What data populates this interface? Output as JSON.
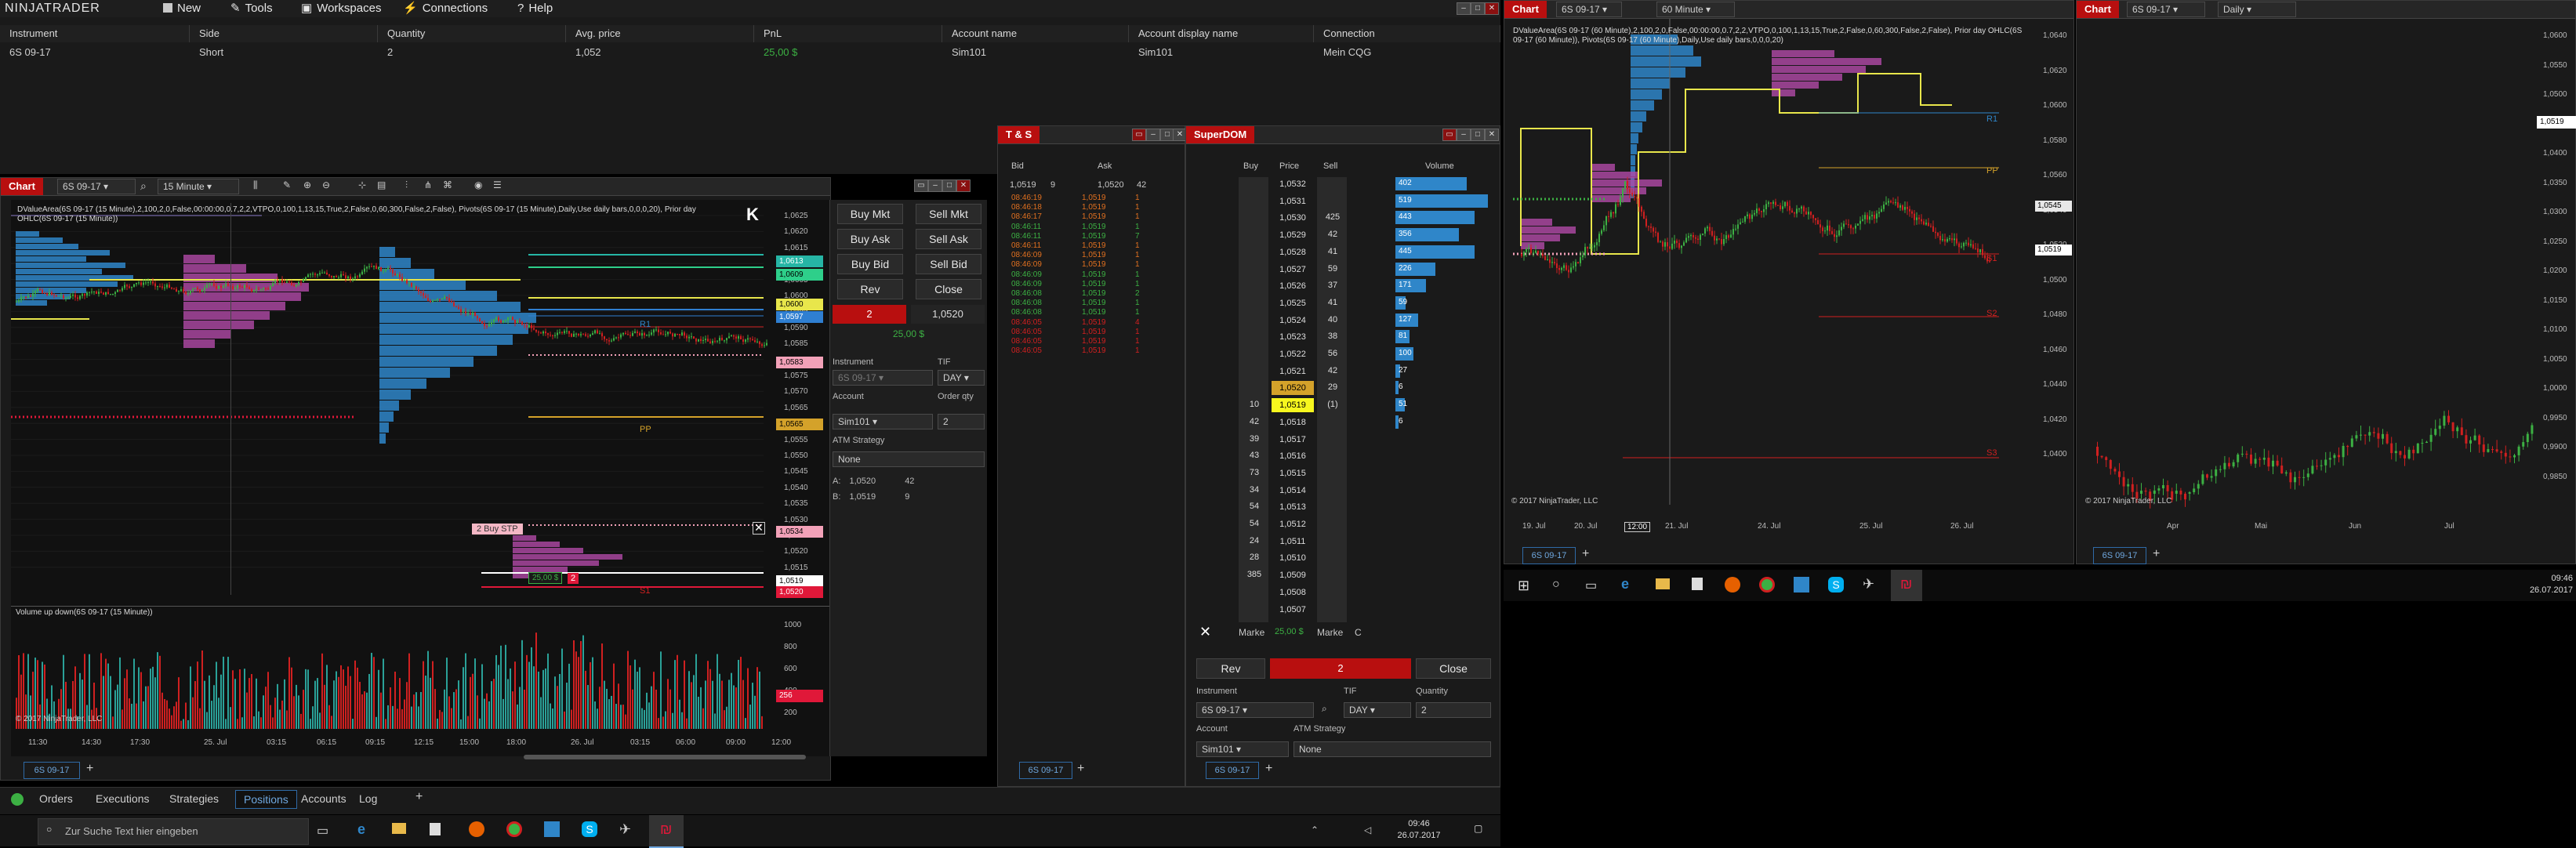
{
  "menu": {
    "logo": "NINJATRADER",
    "items": [
      "New",
      "Tools",
      "Workspaces",
      "Connections",
      "Help"
    ]
  },
  "positions": {
    "columns": [
      "Instrument",
      "Side",
      "Quantity",
      "Avg. price",
      "PnL",
      "Account name",
      "Account display name",
      "Connection"
    ],
    "row": [
      "6S 09-17",
      "Short",
      "2",
      "1,052",
      "25,00 $",
      "Sim101",
      "Sim101",
      "Mein CQG"
    ]
  },
  "chart1": {
    "tab": "Chart",
    "instrument": "6S 09-17",
    "interval": "15 Minute",
    "indicator_text": "DValueArea(6S 09-17 (15 Minute),2,100,2,0,False,00:00:00,0.7,2,2,VTPO,0,100,1,13,15,True,2,False,0,60,300,False,2,False), Pivots(6S 09-17 (15 Minute),Daily,Use daily bars,0,0,0,20), Prior day OHLC(6S 09-17 (15 Minute))",
    "volume_panel": "Volume up down(6S 09-17 (15 Minute))",
    "copyright": "© 2017 NinjaTrader, LLC",
    "x_labels": [
      "11:30",
      "14:30",
      "17:30",
      "25. Jul",
      "03:15",
      "06:15",
      "09:15",
      "12:15",
      "15:00",
      "18:00",
      "26. Jul",
      "03:15",
      "06:00",
      "09:00",
      "12:00"
    ],
    "y_labels": [
      "1,0625",
      "1,0620",
      "1,0615",
      "1,0610",
      "1,0605",
      "1,0600",
      "1,0595",
      "1,0590",
      "1,0585",
      "1,0580",
      "1,0575",
      "1,0570",
      "1,0565",
      "1,0560",
      "1,0555",
      "1,0550",
      "1,0545",
      "1,0540",
      "1,0535",
      "1,0530",
      "1,0525",
      "1,0520",
      "1,0515"
    ],
    "tags": [
      {
        "text": "1,0613",
        "bg": "#26b5a5"
      },
      {
        "text": "1,0609",
        "bg": "#2ecf8a"
      },
      {
        "text": "1,0600",
        "bg": "#e8e64b"
      },
      {
        "text": "1,0597",
        "bg": "#2f7fd1"
      },
      {
        "text": "1,0583",
        "bg": "#f2a1b8"
      },
      {
        "text": "1,0565",
        "bg": "#d4a22a"
      },
      {
        "text": "1,0534",
        "bg": "#f2a1b8"
      },
      {
        "text": "1,0519",
        "bg": "#ffffff"
      },
      {
        "text": "1,0520",
        "bg": "#e01839"
      }
    ],
    "vol_labels": [
      "1000",
      "800",
      "600",
      "400",
      "200"
    ],
    "vol_tag": "256",
    "tab_instrument": "6S 09-17",
    "order_label": "2  Buy STP",
    "order_qty": "2",
    "pnl_tag": "25,00 $",
    "r1": "R1",
    "pp": "PP",
    "s1": "S1"
  },
  "chart_trader": {
    "buy_mkt": "Buy Mkt",
    "sell_mkt": "Sell Mkt",
    "buy_ask": "Buy Ask",
    "sell_ask": "Sell Ask",
    "buy_bid": "Buy Bid",
    "sell_bid": "Sell Bid",
    "rev": "Rev",
    "close": "Close",
    "qty": "2",
    "price": "1,0520",
    "pnl": "25,00 $",
    "instrument_label": "Instrument",
    "tif_label": "TIF",
    "instrument": "6S 09-17",
    "tif": "DAY",
    "account_label": "Account",
    "orderqty_label": "Order qty",
    "account": "Sim101",
    "orderqty": "2",
    "atm_label": "ATM Strategy",
    "atm": "None",
    "ask_label": "A:",
    "ask": "1,0520",
    "ask_size": "42",
    "bid_label": "B:",
    "bid": "1,0519",
    "bid_size": "9"
  },
  "ts": {
    "title": "T & S",
    "bid_label": "Bid",
    "ask_label": "Ask",
    "bid": "1,0519",
    "bid_size": "9",
    "ask": "1,0520",
    "ask_size": "42",
    "rows": [
      {
        "t": "08:46:19",
        "p": "1,0519",
        "s": "1",
        "c": "#e07020"
      },
      {
        "t": "08:46:18",
        "p": "1,0519",
        "s": "1",
        "c": "#e07020"
      },
      {
        "t": "08:46:17",
        "p": "1,0519",
        "s": "1",
        "c": "#e07020"
      },
      {
        "t": "08:46:11",
        "p": "1,0519",
        "s": "1",
        "c": "#3cb043"
      },
      {
        "t": "08:46:11",
        "p": "1,0519",
        "s": "7",
        "c": "#3cb043"
      },
      {
        "t": "08:46:11",
        "p": "1,0519",
        "s": "1",
        "c": "#e07020"
      },
      {
        "t": "08:46:09",
        "p": "1,0519",
        "s": "1",
        "c": "#e07020"
      },
      {
        "t": "08:46:09",
        "p": "1,0519",
        "s": "1",
        "c": "#e07020"
      },
      {
        "t": "08:46:09",
        "p": "1,0519",
        "s": "1",
        "c": "#3cb043"
      },
      {
        "t": "08:46:09",
        "p": "1,0519",
        "s": "1",
        "c": "#3cb043"
      },
      {
        "t": "08:46:08",
        "p": "1,0519",
        "s": "2",
        "c": "#3cb043"
      },
      {
        "t": "08:46:08",
        "p": "1,0519",
        "s": "1",
        "c": "#3cb043"
      },
      {
        "t": "08:46:08",
        "p": "1,0519",
        "s": "1",
        "c": "#3cb043"
      },
      {
        "t": "08:46:05",
        "p": "1,0519",
        "s": "4",
        "c": "#d02020"
      },
      {
        "t": "08:46:05",
        "p": "1,0519",
        "s": "1",
        "c": "#d02020"
      },
      {
        "t": "08:46:05",
        "p": "1,0519",
        "s": "1",
        "c": "#d02020"
      },
      {
        "t": "08:46:05",
        "p": "1,0519",
        "s": "1",
        "c": "#d02020"
      }
    ],
    "tab_instrument": "6S 09-17"
  },
  "dom": {
    "title": "SuperDOM",
    "col_buy": "Buy",
    "col_price": "Price",
    "col_sell": "Sell",
    "col_volume": "Volume",
    "rows": [
      {
        "buy": "",
        "price": "1,0532",
        "sell": "",
        "vol": "402"
      },
      {
        "buy": "",
        "price": "1,0531",
        "sell": "",
        "vol": "519"
      },
      {
        "buy": "",
        "price": "1,0530",
        "sell": "425",
        "vol": "443"
      },
      {
        "buy": "",
        "price": "1,0529",
        "sell": "42",
        "vol": "356"
      },
      {
        "buy": "",
        "price": "1,0528",
        "sell": "41",
        "vol": "445"
      },
      {
        "buy": "",
        "price": "1,0527",
        "sell": "59",
        "vol": "226"
      },
      {
        "buy": "",
        "price": "1,0526",
        "sell": "37",
        "vol": "171"
      },
      {
        "buy": "",
        "price": "1,0525",
        "sell": "41",
        "vol": "59"
      },
      {
        "buy": "",
        "price": "1,0524",
        "sell": "40",
        "vol": "127"
      },
      {
        "buy": "",
        "price": "1,0523",
        "sell": "38",
        "vol": "81"
      },
      {
        "buy": "",
        "price": "1,0522",
        "sell": "56",
        "vol": "100"
      },
      {
        "buy": "",
        "price": "1,0521",
        "sell": "42",
        "vol": "27"
      },
      {
        "buy": "",
        "price": "1,0520",
        "sell": "29",
        "vol": "6"
      },
      {
        "buy": "10",
        "price": "1,0519",
        "sell": "(1)",
        "vol": "51"
      },
      {
        "buy": "42",
        "price": "1,0518",
        "sell": "",
        "vol": "6"
      },
      {
        "buy": "39",
        "price": "1,0517",
        "sell": "",
        "vol": ""
      },
      {
        "buy": "43",
        "price": "1,0516",
        "sell": "",
        "vol": ""
      },
      {
        "buy": "73",
        "price": "1,0515",
        "sell": "",
        "vol": ""
      },
      {
        "buy": "34",
        "price": "1,0514",
        "sell": "",
        "vol": ""
      },
      {
        "buy": "54",
        "price": "1,0513",
        "sell": "",
        "vol": ""
      },
      {
        "buy": "54",
        "price": "1,0512",
        "sell": "",
        "vol": ""
      },
      {
        "buy": "24",
        "price": "1,0511",
        "sell": "",
        "vol": ""
      },
      {
        "buy": "28",
        "price": "1,0510",
        "sell": "",
        "vol": ""
      },
      {
        "buy": "385",
        "price": "1,0509",
        "sell": "",
        "vol": ""
      },
      {
        "buy": "",
        "price": "1,0508",
        "sell": "",
        "vol": ""
      },
      {
        "buy": "",
        "price": "1,0507",
        "sell": "",
        "vol": ""
      }
    ],
    "market_buy": "Marke",
    "pnl": "25,00 $",
    "market_sell": "Marke",
    "c_label": "C",
    "rev": "Rev",
    "qty": "2",
    "close": "Close",
    "instrument_label": "Instrument",
    "tif_label": "TIF",
    "quantity_label": "Quantity",
    "instrument": "6S 09-17",
    "tif": "DAY",
    "quantity": "2",
    "account_label": "Account",
    "atm_label": "ATM Strategy",
    "account": "Sim101",
    "atm": "None",
    "tab_instrument": "6S 09-17"
  },
  "chart2": {
    "tab": "Chart",
    "instrument": "6S 09-17",
    "interval": "60 Minute",
    "indicator_text": "DValueArea(6S 09-17 (60 Minute),2,100,2,0,False,00:00:00,0.7,2,2,VTPO,0,100,1,13,15,True,2,False,0,60,300,False,2,False), Prior day OHLC(6S 09-17 (60 Minute)), Pivots(6S 09-17 (60 Minute),Daily,Use daily bars,0,0,0,20)",
    "copyright": "© 2017 NinjaTrader, LLC",
    "x_labels": [
      "19. Jul",
      "20. Jul",
      "12:00",
      "21. Jul",
      "24. Jul",
      "25. Jul",
      "26. Jul"
    ],
    "y_labels": [
      "1,0640",
      "1,0620",
      "1,0600",
      "1,0580",
      "1,0560",
      "1,0540",
      "1,0520",
      "1,0500",
      "1,0480",
      "1,0460",
      "1,0440",
      "1,0420",
      "1,0400"
    ],
    "tags": [
      {
        "text": "1,0545",
        "bg": "#e8e8e8"
      },
      {
        "text": "1,0519",
        "bg": "#ffffff"
      }
    ],
    "r1": "R1",
    "pp": "PP",
    "s1": "S1",
    "s2": "S2",
    "s3": "S3",
    "tab_instrument": "6S 09-17"
  },
  "chart3": {
    "tab": "Chart",
    "instrument": "6S 09-17",
    "interval": "Daily",
    "copyright": "© 2017 NinjaTrader, LLC",
    "x_labels": [
      "Apr",
      "Mai",
      "Jun",
      "Jul"
    ],
    "y_labels": [
      "1,0600",
      "1,0550",
      "1,0500",
      "1,0450",
      "1,0400",
      "1,0350",
      "1,0300",
      "1,0250",
      "1,0200",
      "1,0150",
      "1,0100",
      "1,0050",
      "1,0000",
      "0,9950",
      "0,9900",
      "0,9850"
    ],
    "tag": "1,0519",
    "tab_instrument": "6S 09-17"
  },
  "control_center": {
    "tabs": [
      "Orders",
      "Executions",
      "Strategies",
      "Positions",
      "Accounts",
      "Log"
    ],
    "active": "Positions"
  },
  "taskbar": {
    "search_placeholder": "Zur Suche Text hier eingeben",
    "time": "09:46",
    "date": "26.07.2017"
  },
  "taskbar2": {
    "time": "09:46",
    "date": "26.07.2017"
  },
  "colors": {
    "up": "#3cb043",
    "down": "#d02020",
    "red_tab": "#b80f0f",
    "profile_blue": "#2f86c9",
    "profile_magenta": "#b14aa8"
  }
}
